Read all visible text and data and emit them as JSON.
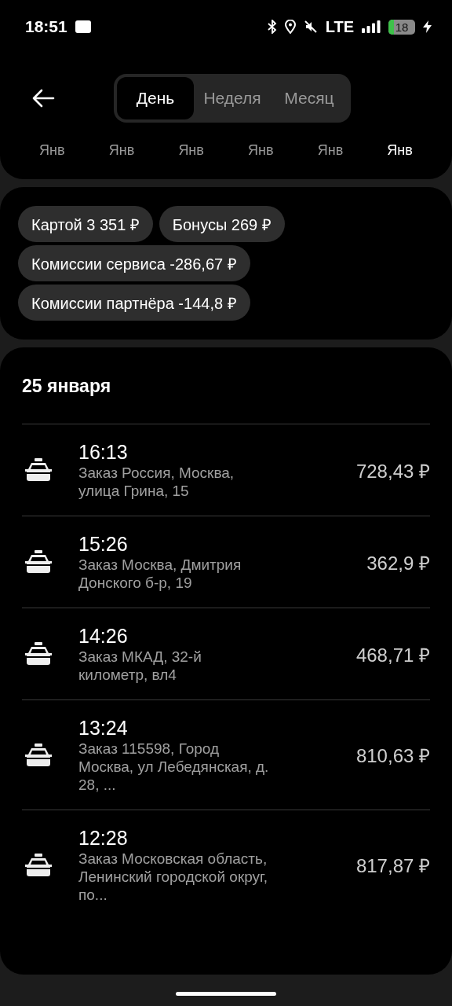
{
  "status_bar": {
    "time": "18:51",
    "network": "LTE",
    "battery": "18"
  },
  "header": {
    "tabs": [
      {
        "label": "День",
        "selected": true
      },
      {
        "label": "Неделя",
        "selected": false
      },
      {
        "label": "Месяц",
        "selected": false
      }
    ],
    "months": [
      {
        "label": "Янв",
        "selected": false
      },
      {
        "label": "Янв",
        "selected": false
      },
      {
        "label": "Янв",
        "selected": false
      },
      {
        "label": "Янв",
        "selected": false
      },
      {
        "label": "Янв",
        "selected": false
      },
      {
        "label": "Янв",
        "selected": true
      }
    ]
  },
  "summary_chips": [
    "Картой 3 351 ₽",
    "Бонусы 269 ₽",
    "Комиссии сервиса -286,67 ₽",
    "Комиссии партнёра -144,8 ₽"
  ],
  "orders": {
    "date": "25 января",
    "items": [
      {
        "time": "16:13",
        "address": "Заказ Россия, Москва, улица Грина, 15",
        "amount": "728,43 ₽"
      },
      {
        "time": "15:26",
        "address": "Заказ Москва, Дмитрия Донского б-р, 19",
        "amount": "362,9 ₽"
      },
      {
        "time": "14:26",
        "address": "Заказ МКАД, 32-й километр, вл4",
        "amount": "468,71 ₽"
      },
      {
        "time": "13:24",
        "address": "Заказ 115598, Город Москва, ул Лебедянская, д. 28, ...",
        "amount": "810,63 ₽"
      },
      {
        "time": "12:28",
        "address": "Заказ Московская область, Ленинский городской округ, по...",
        "amount": "817,87 ₽"
      }
    ]
  }
}
